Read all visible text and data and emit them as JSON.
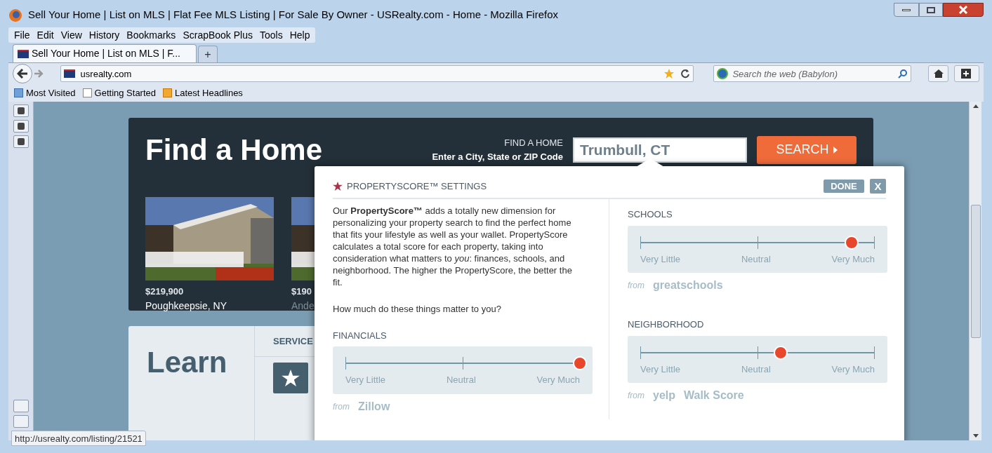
{
  "window": {
    "title": "Sell Your Home | List on MLS | Flat Fee MLS Listing | For Sale By Owner - USRealty.com - Home - Mozilla Firefox"
  },
  "menu": [
    "File",
    "Edit",
    "View",
    "History",
    "Bookmarks",
    "ScrapBook Plus",
    "Tools",
    "Help"
  ],
  "tabs": [
    {
      "label": "Sell Your Home | List on MLS | F...",
      "selected": true
    }
  ],
  "new_tab": "+",
  "address": "usrealty.com",
  "search": {
    "placeholder": "Search the web (Babylon)"
  },
  "bookmarks": [
    "Most Visited",
    "Getting Started",
    "Latest Headlines"
  ],
  "find_home": {
    "title": "Find a Home",
    "label": "FIND A HOME",
    "hint": "Enter a City, State or ZIP Code",
    "value": "Trumbull, CT",
    "button": "SEARCH"
  },
  "listings": [
    {
      "price": "$219,900",
      "city": "Poughkeepsie, NY"
    },
    {
      "price": "$190",
      "city": "Ande"
    }
  ],
  "learn": {
    "title": "Learn",
    "tab": "SERVICE"
  },
  "popup": {
    "title": "PROPERTYSCORE™ SETTINGS",
    "done": "DONE",
    "close": "X",
    "intro": "Our **PropertyScore™** adds a totally new dimension for personalizing your property search to find the perfect home that fits your lifestyle as well as your wallet. PropertyScore calculates a total score for each property, taking into consideration what matters to *you*: finances, schools, and neighborhood. The higher the PropertyScore, the better the fit.",
    "question": "How much do these things matter to you?",
    "sliders": [
      {
        "label": "FINANCIALS",
        "level": 1,
        "ticks": [
          "Very Little",
          "Neutral",
          "Very Much"
        ],
        "from": "from",
        "sources": [
          "Zillow"
        ]
      },
      {
        "label": "SCHOOLS",
        "level": 0.9,
        "ticks": [
          "Very Little",
          "Neutral",
          "Very Much"
        ],
        "from": "from",
        "sources": [
          "greatschools"
        ]
      },
      {
        "label": "NEIGHBORHOOD",
        "level": 0.6,
        "ticks": [
          "Very Little",
          "Neutral",
          "Very Much"
        ],
        "from": "from",
        "sources": [
          "yelp",
          "Walk Score"
        ]
      }
    ]
  },
  "status": "http://usrealty.com/listing/21521"
}
